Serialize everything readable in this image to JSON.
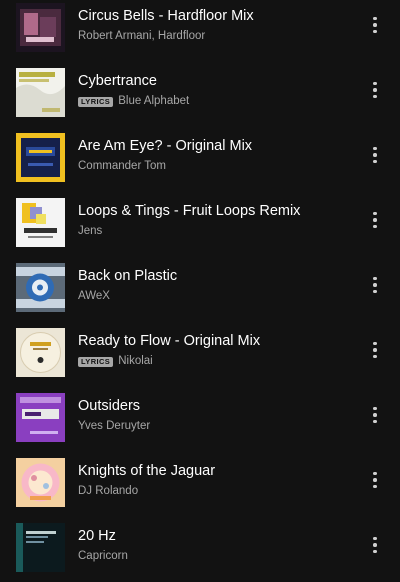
{
  "tracks": [
    {
      "title": "Circus Bells - Hardfloor Mix",
      "artist": "Robert Armani, Hardfloor",
      "lyrics": "",
      "art": "album-art-circus-bells"
    },
    {
      "title": "Cybertrance",
      "artist": "Blue Alphabet",
      "lyrics": "LYRICS",
      "art": "album-art-cybertrance"
    },
    {
      "title": "Are Am Eye? - Original Mix",
      "artist": "Commander Tom",
      "lyrics": "",
      "art": "album-art-are-am-eye"
    },
    {
      "title": "Loops & Tings - Fruit Loops Remix",
      "artist": "Jens",
      "lyrics": "",
      "art": "album-art-loops-and-tings"
    },
    {
      "title": "Back on Plastic",
      "artist": "AWeX",
      "lyrics": "",
      "art": "album-art-back-on-plastic"
    },
    {
      "title": "Ready to Flow - Original Mix",
      "artist": "Nikolai",
      "lyrics": "LYRICS",
      "art": "album-art-ready-to-flow"
    },
    {
      "title": "Outsiders",
      "artist": "Yves Deruyter",
      "lyrics": "",
      "art": "album-art-outsiders"
    },
    {
      "title": "Knights of the Jaguar",
      "artist": "DJ Rolando",
      "lyrics": "",
      "art": "album-art-knights-of-the-jaguar"
    },
    {
      "title": "20 Hz",
      "artist": "Capricorn",
      "lyrics": "",
      "art": "album-art-20-hz"
    }
  ],
  "icons": {
    "more": "more-options-vertical-dots-icon"
  },
  "colors": {
    "background": "#121212",
    "title": "#ffffff",
    "subtitle": "#a7a7a7",
    "badge": "#a7a7a7"
  }
}
